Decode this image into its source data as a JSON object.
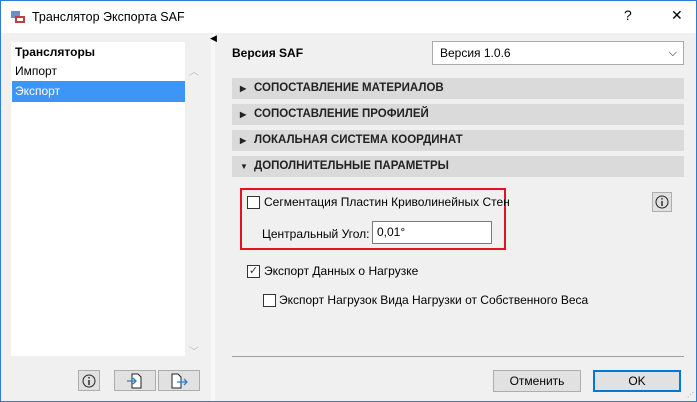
{
  "window": {
    "title": "Транслятор Экспорта SAF",
    "help": "?",
    "close": "✕"
  },
  "sidebar": {
    "header": "Трансляторы",
    "items": [
      {
        "label": "Импорт",
        "selected": false
      },
      {
        "label": "Экспорт",
        "selected": true
      }
    ],
    "info_button": "i"
  },
  "main": {
    "version_label": "Версия SAF",
    "version_value": "Версия 1.0.6",
    "sections": [
      {
        "label": "СОПОСТАВЛЕНИЕ МАТЕРИАЛОВ",
        "expanded": false
      },
      {
        "label": "СОПОСТАВЛЕНИЕ ПРОФИЛЕЙ",
        "expanded": false
      },
      {
        "label": "ЛОКАЛЬНАЯ СИСТЕМА КООРДИНАТ",
        "expanded": false
      },
      {
        "label": "ДОПОЛНИТЕЛЬНЫЕ ПАРАМЕТРЫ",
        "expanded": true
      }
    ],
    "segmentation": {
      "label": "Сегментация Пластин Криволинейных Стен",
      "checked": false
    },
    "angle": {
      "label": "Центральный Угол:",
      "value": "0,01°"
    },
    "load_export": {
      "label": "Экспорт Данных о Нагрузке",
      "checked": true
    },
    "self_weight": {
      "label": "Экспорт Нагрузок Вида Нагрузки от Собственного Веса",
      "checked": false
    }
  },
  "footer": {
    "cancel": "Отменить",
    "ok": "OK"
  },
  "colors": {
    "accent": "#3d96f7",
    "highlight": "#e81123",
    "ok_border": "#0078d7"
  }
}
